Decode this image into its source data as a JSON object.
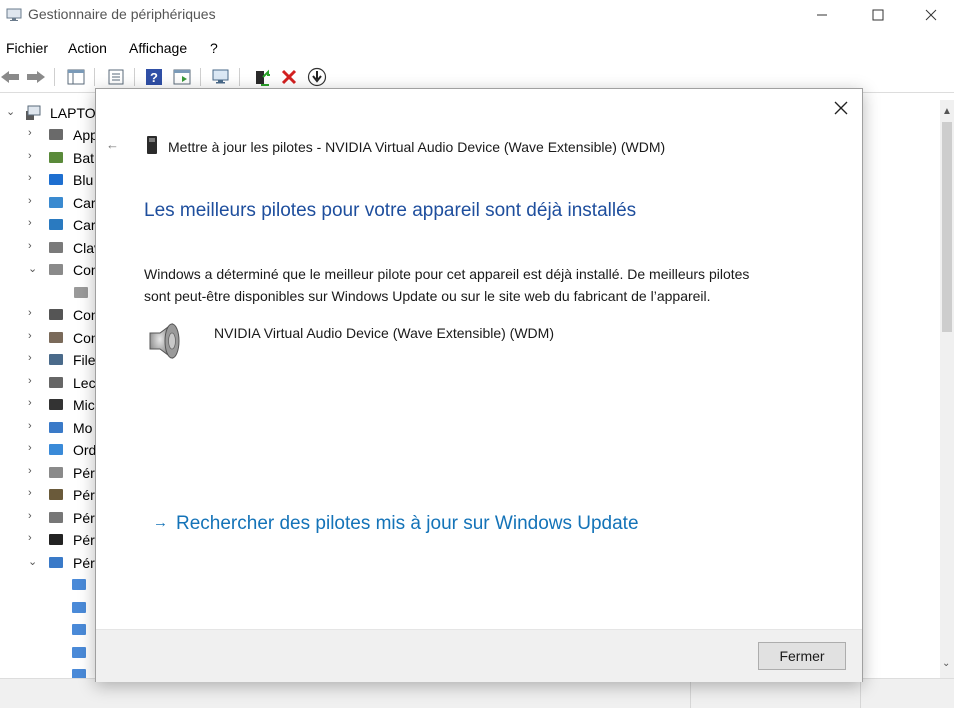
{
  "window": {
    "title": "Gestionnaire de périphériques",
    "minimize_icon": "minimize-icon",
    "maximize_icon": "maximize-icon",
    "close_icon": "close-icon"
  },
  "menu": {
    "items": [
      "Fichier",
      "Action",
      "Affichage",
      "?"
    ]
  },
  "toolbar": {
    "icons": [
      "back-arrow-icon",
      "forward-arrow-icon",
      "properties-pane-icon",
      "properties-list-icon",
      "help-icon",
      "run-pane-icon",
      "scan-monitor-icon",
      "update-driver-icon",
      "uninstall-icon",
      "download-icon"
    ]
  },
  "tree": {
    "root": "LAPTOP",
    "items": [
      {
        "label": "App",
        "icon": "webcam-icon",
        "expander": "›"
      },
      {
        "label": "Bat",
        "icon": "battery-icon",
        "expander": "›"
      },
      {
        "label": "Blu",
        "icon": "bluetooth-icon",
        "expander": "›"
      },
      {
        "label": "Car",
        "icon": "network-card-icon",
        "expander": "›"
      },
      {
        "label": "Car",
        "icon": "display-adapter-icon",
        "expander": "›"
      },
      {
        "label": "Clav",
        "icon": "keyboard-icon",
        "expander": "›"
      },
      {
        "label": "Con",
        "icon": "speaker-icon",
        "expander": "⌄"
      },
      {
        "label": "",
        "icon": "speaker-small-icon",
        "expander": ""
      },
      {
        "label": "Con",
        "icon": "usb-controller-icon",
        "expander": "›"
      },
      {
        "label": "Con",
        "icon": "system-controller-icon",
        "expander": "›"
      },
      {
        "label": "File",
        "icon": "print-queue-icon",
        "expander": "›"
      },
      {
        "label": "Lect",
        "icon": "disk-drive-icon",
        "expander": "›"
      },
      {
        "label": "Mic",
        "icon": "processor-icon",
        "expander": "›"
      },
      {
        "label": "Mo",
        "icon": "monitor-icon",
        "expander": "›"
      },
      {
        "label": "Ord",
        "icon": "computer-icon",
        "expander": "›"
      },
      {
        "label": "Péri",
        "icon": "biometric-icon",
        "expander": "›"
      },
      {
        "label": "Péri",
        "icon": "security-device-icon",
        "expander": "›"
      },
      {
        "label": "Péri",
        "icon": "hid-device-icon",
        "expander": "›"
      },
      {
        "label": "Péri",
        "icon": "portable-device-icon",
        "expander": "›"
      },
      {
        "label": "Péri",
        "icon": "software-device-icon",
        "expander": "⌄"
      },
      {
        "label": "",
        "icon": "software-device-child-icon",
        "expander": ""
      },
      {
        "label": "",
        "icon": "software-device-child-icon",
        "expander": ""
      },
      {
        "label": "",
        "icon": "software-device-child-icon",
        "expander": ""
      },
      {
        "label": "",
        "icon": "software-device-child-icon",
        "expander": ""
      },
      {
        "label": "",
        "icon": "software-device-child-icon",
        "expander": ""
      }
    ]
  },
  "dialog": {
    "header_title": "Mettre à jour les pilotes - NVIDIA Virtual Audio Device (Wave Extensible) (WDM)",
    "heading": "Les meilleurs pilotes pour votre appareil sont déjà installés",
    "body_line1": "Windows a déterminé que le meilleur pilote pour cet appareil est déjà installé. De meilleurs pilotes",
    "body_line2": "sont peut-être disponibles sur Windows Update ou sur le site web du fabricant de l’appareil.",
    "device_name": "NVIDIA Virtual Audio Device (Wave Extensible) (WDM)",
    "update_link": "Rechercher des pilotes mis à jour sur Windows Update",
    "close_button": "Fermer"
  },
  "colors": {
    "heading": "#1e4e9d",
    "link": "#1473b8",
    "footer_bg": "#f0f0f0"
  }
}
